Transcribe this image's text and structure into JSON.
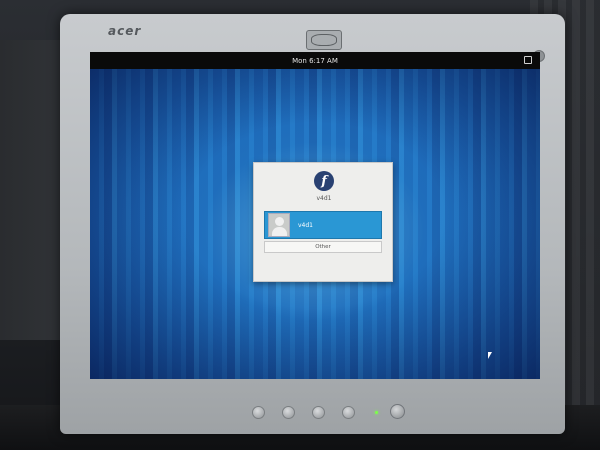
{
  "monitor": {
    "brand": "acer"
  },
  "topbar": {
    "clock": "Mon 6:17 AM",
    "power_icon": "power-menu-icon"
  },
  "login": {
    "logo_glyph": "f",
    "logo_icon": "fedora-logo-icon",
    "hostname": "v4d1",
    "users": [
      {
        "name": "v4d1",
        "avatar_icon": "user-avatar-icon",
        "selected": true
      }
    ],
    "other_label": "Other"
  },
  "colors": {
    "selection": "#2a97d4",
    "topbar": "#0a0a0a",
    "background": "#1c63b4"
  }
}
